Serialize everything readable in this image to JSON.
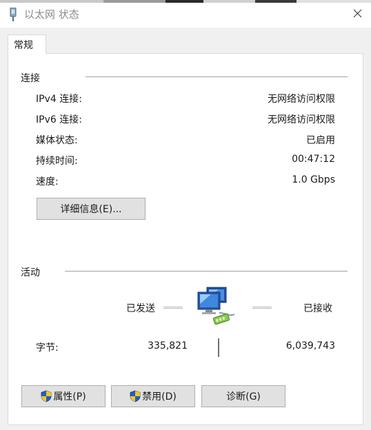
{
  "window": {
    "title": "以太网 状态"
  },
  "tabs": [
    {
      "label": "常规"
    }
  ],
  "connection": {
    "section_title": "连接",
    "rows": [
      {
        "label": "IPv4 连接:",
        "value": "无网络访问权限"
      },
      {
        "label": "IPv6 连接:",
        "value": "无网络访问权限"
      },
      {
        "label": "媒体状态:",
        "value": "已启用"
      },
      {
        "label": "持续时间:",
        "value": "00:47:12"
      },
      {
        "label": "速度:",
        "value": "1.0 Gbps"
      }
    ],
    "details_button": "详细信息(E)..."
  },
  "activity": {
    "section_title": "活动",
    "sent_label": "已发送",
    "received_label": "已接收",
    "bytes_label": "字节:",
    "bytes_sent": "335,821",
    "bytes_received": "6,039,743"
  },
  "buttons": {
    "properties": "属性(P)",
    "disable": "禁用(D)",
    "diagnose": "诊断(G)"
  },
  "icons": {
    "title": "network-adapter-icon",
    "close": "close-icon",
    "network": "network-computers-icon",
    "shield": "uac-shield-icon"
  },
  "colors": {
    "dialog_bg": "#f0f0f0",
    "panel_bg": "#ffffff",
    "button_bg": "#e1e1e1",
    "button_border": "#adadad",
    "separator": "#a0a0a0"
  }
}
